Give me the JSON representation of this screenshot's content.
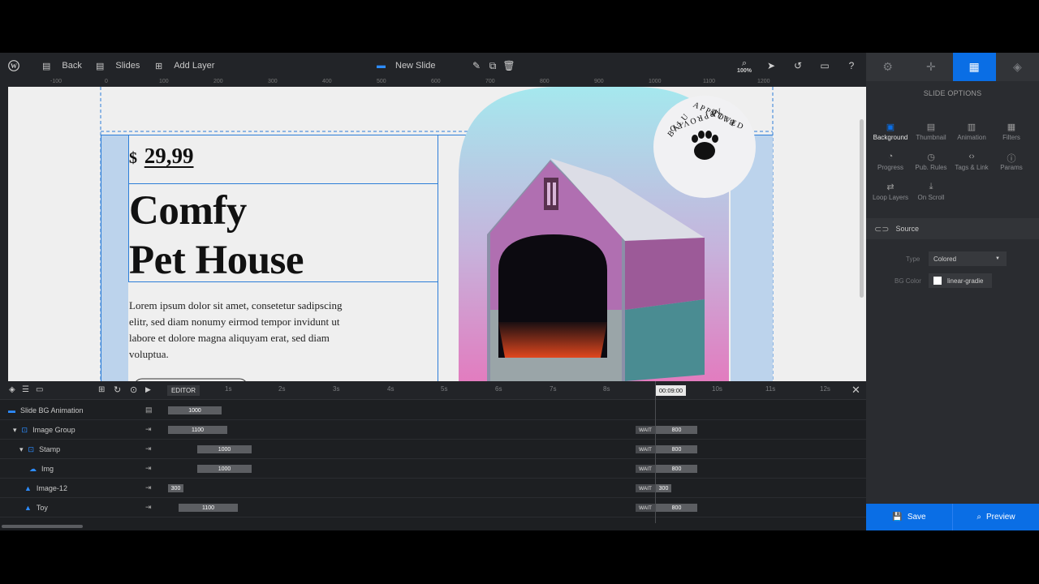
{
  "colors": {
    "accent": "#0a6ee5",
    "panel": "#2a2c30",
    "toolbar": "#222428",
    "canvas": "#efefef"
  },
  "toolbar": {
    "back_label": "Back",
    "slides_label": "Slides",
    "add_layer_label": "Add Layer",
    "slide_name": "New Slide",
    "zoom": "100%"
  },
  "ruler": {
    "ticks": [
      "-100",
      "0",
      "100",
      "200",
      "300",
      "400",
      "500",
      "600",
      "700",
      "800",
      "900",
      "1000",
      "1100",
      "1200"
    ]
  },
  "slide": {
    "price_currency": "$",
    "price_value": "29,99",
    "title_line1": "Comfy",
    "title_line2": "Pet House",
    "body": "Lorem ipsum dolor sit amet, consetetur sadipscing elitr, sed diam nonumy eirmod tempor invidunt ut labore et dolore magna aliquyam erat, sed diam voluptua.",
    "stamp_text": "BALU APPROVED APPROVED BALU"
  },
  "right_panel": {
    "tabs": [
      "gear-icon",
      "target-icon",
      "slide-options-icon",
      "layers-icon"
    ],
    "title": "SLIDE OPTIONS",
    "options": [
      {
        "label": "Background",
        "icon": "background-icon",
        "active": true
      },
      {
        "label": "Thumbnail",
        "icon": "thumbnail-icon"
      },
      {
        "label": "Animation",
        "icon": "animation-icon"
      },
      {
        "label": "Filters",
        "icon": "filters-icon"
      },
      {
        "label": "Progress",
        "icon": "progress-icon"
      },
      {
        "label": "Pub. Rules",
        "icon": "clock-icon"
      },
      {
        "label": "Tags & Link",
        "icon": "code-icon"
      },
      {
        "label": "Params",
        "icon": "info-icon"
      },
      {
        "label": "Loop Layers",
        "icon": "loop-icon"
      },
      {
        "label": "On Scroll",
        "icon": "download-icon"
      }
    ],
    "section": "Source",
    "type_label": "Type",
    "type_value": "Colored",
    "bgcolor_label": "BG Color",
    "bgcolor_value": "linear-gradie",
    "save_label": "Save",
    "preview_label": "Preview"
  },
  "timeline": {
    "editor_label": "EDITOR",
    "time_marks": [
      "1s",
      "2s",
      "3s",
      "4s",
      "5s",
      "6s",
      "7s",
      "8s",
      "10s",
      "11s",
      "12s"
    ],
    "current_time": "00:09:00",
    "rows": [
      {
        "label": "Slide BG Animation",
        "bar": "1000",
        "wait": "",
        "end": ""
      },
      {
        "label": "Image Group",
        "bar": "1100",
        "wait": "WAIT",
        "end": "800"
      },
      {
        "label": "Stamp",
        "bar": "1000",
        "wait": "WAIT",
        "end": "800"
      },
      {
        "label": "Img",
        "bar": "1000",
        "wait": "WAIT",
        "end": "800"
      },
      {
        "label": "Image-12",
        "bar": "300",
        "wait": "WAIT",
        "end": "300"
      },
      {
        "label": "Toy",
        "bar": "1100",
        "wait": "WAIT",
        "end": "800"
      }
    ]
  }
}
